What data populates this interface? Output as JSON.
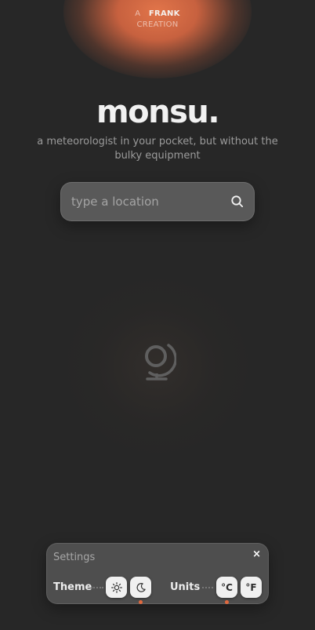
{
  "brand": {
    "prefix": "A",
    "name": "FRANK",
    "line2": "CREATION"
  },
  "hero": {
    "title": "monsu.",
    "subtitle": "a meteorologist in your pocket, but without the bulky equipment"
  },
  "search": {
    "placeholder": "type a location",
    "value": "",
    "icon": "search-icon"
  },
  "placeholder_icon": "globe-icon",
  "settings": {
    "title": "Settings",
    "close_label": "×",
    "theme": {
      "label": "Theme",
      "options": [
        "light",
        "dark"
      ],
      "selected": "dark"
    },
    "units": {
      "label": "Units",
      "celsius": "°C",
      "fahrenheit": "°F",
      "selected": "celsius"
    }
  },
  "colors": {
    "accent": "#e0683e",
    "background": "#272727",
    "panel": "#4e4e4e"
  }
}
